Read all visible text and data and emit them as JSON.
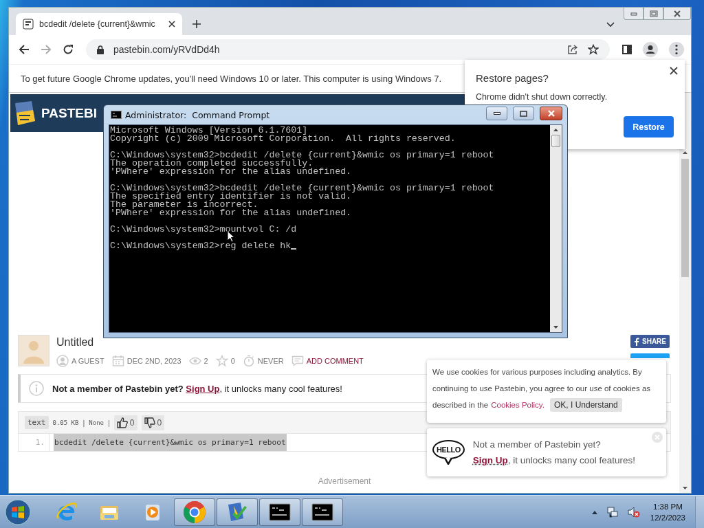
{
  "browser": {
    "tab": {
      "title": "bcdedit /delete {current}&wmic"
    },
    "address": "pastebin.com/yRVdDd4h",
    "infobar": "To get future Google Chrome updates, you'll need Windows 10 or later. This computer is using Windows 7.",
    "page": {
      "logo": "PASTEBI",
      "paste": {
        "title": "Untitled",
        "meta": [
          {
            "kind": "user",
            "text": "A GUEST"
          },
          {
            "kind": "date",
            "text": "DEC 2ND, 2023"
          },
          {
            "kind": "views",
            "text": "2"
          },
          {
            "kind": "stars",
            "text": "0"
          },
          {
            "kind": "expire",
            "text": "NEVER"
          },
          {
            "kind": "comment",
            "text": "ADD COMMENT"
          }
        ],
        "share": "SHARE",
        "notice": {
          "lead": "Not a member of Pastebin yet?",
          "link": "Sign Up",
          "rest": ", it unlocks many cool features!"
        },
        "toolbar": {
          "syntax": "text",
          "size": "0.05 KB",
          "license": "None",
          "separators": [
            "|",
            "|"
          ],
          "likes": "0",
          "dislikes": "0"
        },
        "lines": [
          {
            "number": "1.",
            "code": "bcdedit /delete {current}&wmic os primary=1 reboot",
            "selected": true
          }
        ]
      },
      "advertisement": "Advertisement"
    },
    "restore_popup": {
      "title": "Restore pages?",
      "message": "Chrome didn't shut down correctly.",
      "button": "Restore"
    },
    "cookie_banner": {
      "lines": [
        "We use cookies for various purposes including analytics. By",
        "continuing to use Pastebin, you agree to our use of cookies as",
        "described in the"
      ],
      "link": "Cookies Policy.",
      "button": "OK, I Understand"
    },
    "hello_popup": {
      "badge": "HELLO",
      "lead": "Not a member of Pastebin yet?",
      "link": "Sign Up",
      "rest": ", it unlocks many cool features!"
    }
  },
  "cmd": {
    "title": "Administrator:  Command Prompt",
    "groups": [
      {
        "kind": "output",
        "lines": [
          "Microsoft Windows [Version 6.1.7601]",
          "Copyright (c) 2009 Microsoft Corporation.  All rights reserved."
        ]
      },
      {
        "kind": "output",
        "lines": [
          "C:\\Windows\\system32>bcdedit /delete {current}&wmic os primary=1 reboot",
          "The operation completed successfully.",
          "'PWhere' expression for the alias undefined."
        ]
      },
      {
        "kind": "output",
        "lines": [
          "C:\\Windows\\system32>bcdedit /delete {current}&wmic os primary=1 reboot",
          "The specified entry identifier is not valid.",
          "The parameter is incorrect.",
          "'PWhere' expression for the alias undefined."
        ]
      },
      {
        "kind": "output",
        "lines": [
          "C:\\Windows\\system32>mountvol C: /d"
        ]
      },
      {
        "kind": "prompt",
        "lines": [
          "C:\\Windows\\system32>reg delete hk"
        ]
      }
    ]
  },
  "taskbar": {
    "apps": [
      {
        "kind": "ie",
        "running": false
      },
      {
        "kind": "explorer",
        "running": false
      },
      {
        "kind": "media",
        "running": false
      },
      {
        "kind": "chrome",
        "running": true
      },
      {
        "kind": "security",
        "running": true
      },
      {
        "kind": "console",
        "running": true
      },
      {
        "kind": "console",
        "running": true
      }
    ],
    "time": "1:38 PM",
    "date": "12/2/2023"
  }
}
